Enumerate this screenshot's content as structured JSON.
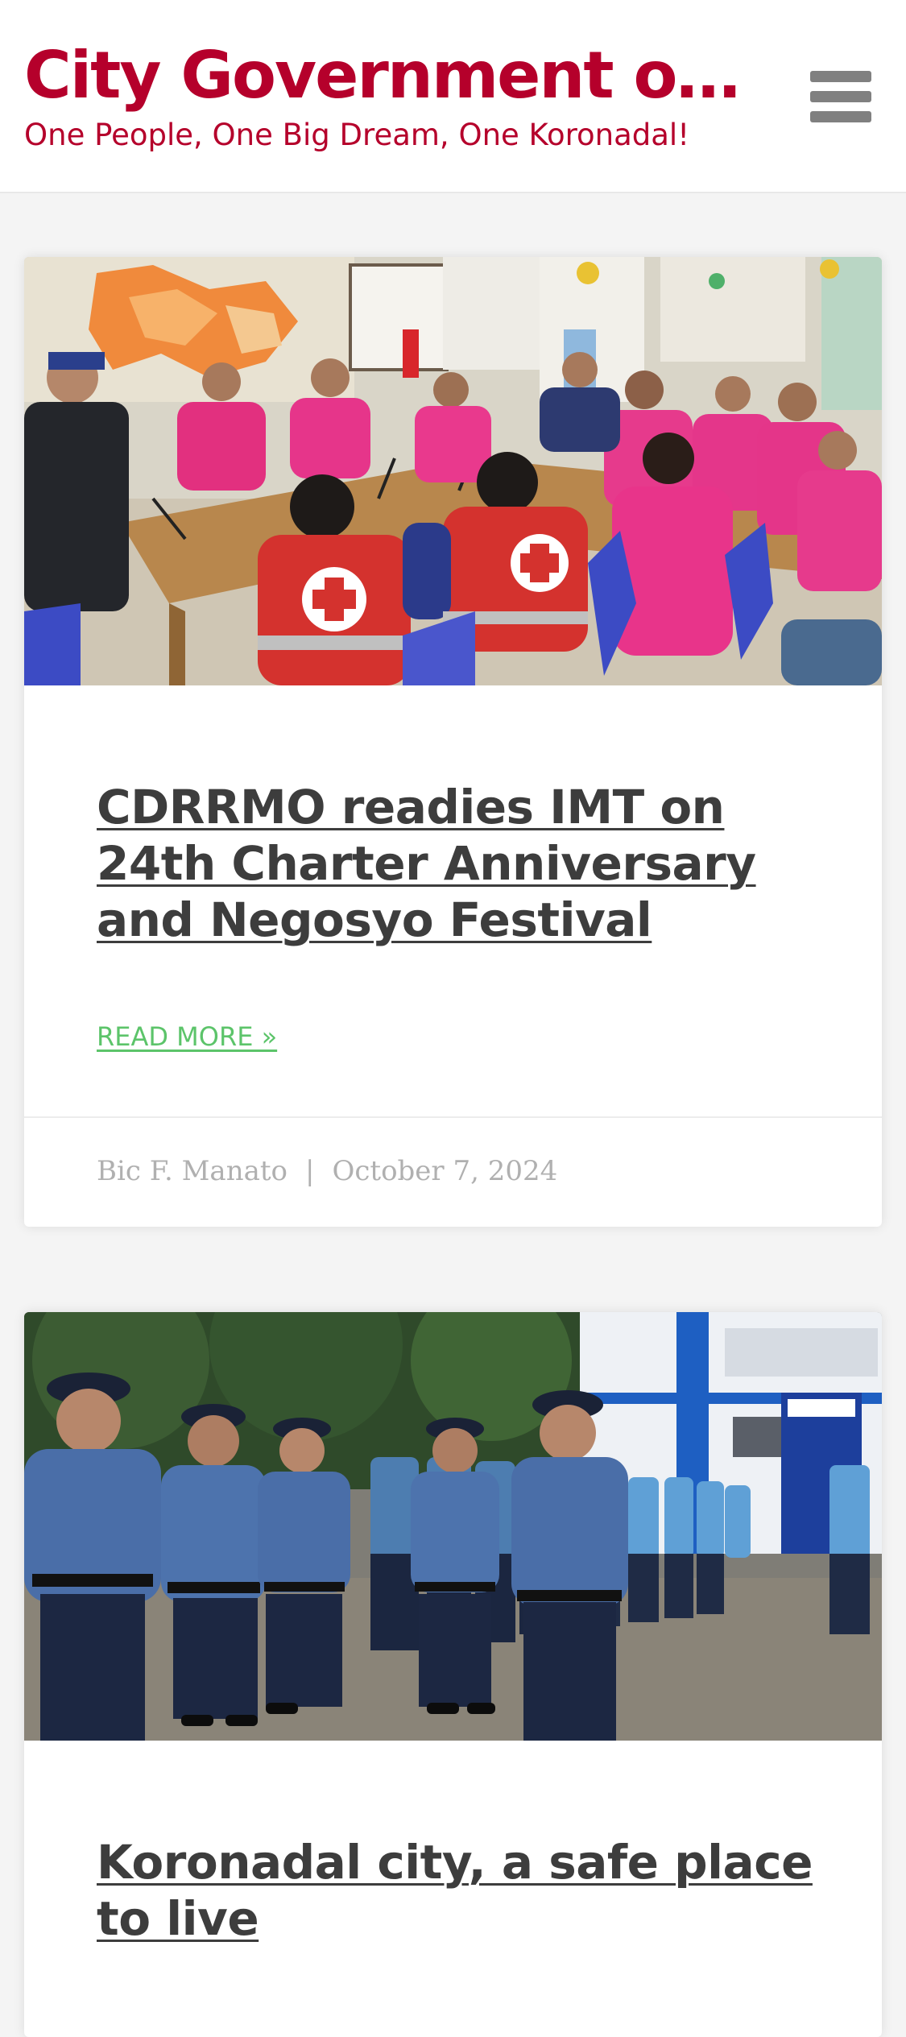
{
  "header": {
    "site_title": "City Government of Koronadal",
    "tagline": "One People, One Big Dream, One Koronadal!",
    "menu_icon": "hamburger-menu-icon"
  },
  "colors": {
    "brand": "#b5002b",
    "read_more": "#5cc46a",
    "meta": "#b0b0b0",
    "title": "#3d3d3d"
  },
  "posts": [
    {
      "image_alt": "CDRRMO meeting with Red Cross volunteers and officials around conference tables",
      "title": "CDRRMO readies IMT on 24th Charter Anniversary and Negosyo Festival",
      "read_more": "READ MORE »",
      "author": "Bic F. Manato",
      "separator": "|",
      "date": "October 7, 2024"
    },
    {
      "image_alt": "Police officers in blue uniforms standing in formation outside a building",
      "title": "Koronadal city, a safe place to live"
    }
  ]
}
